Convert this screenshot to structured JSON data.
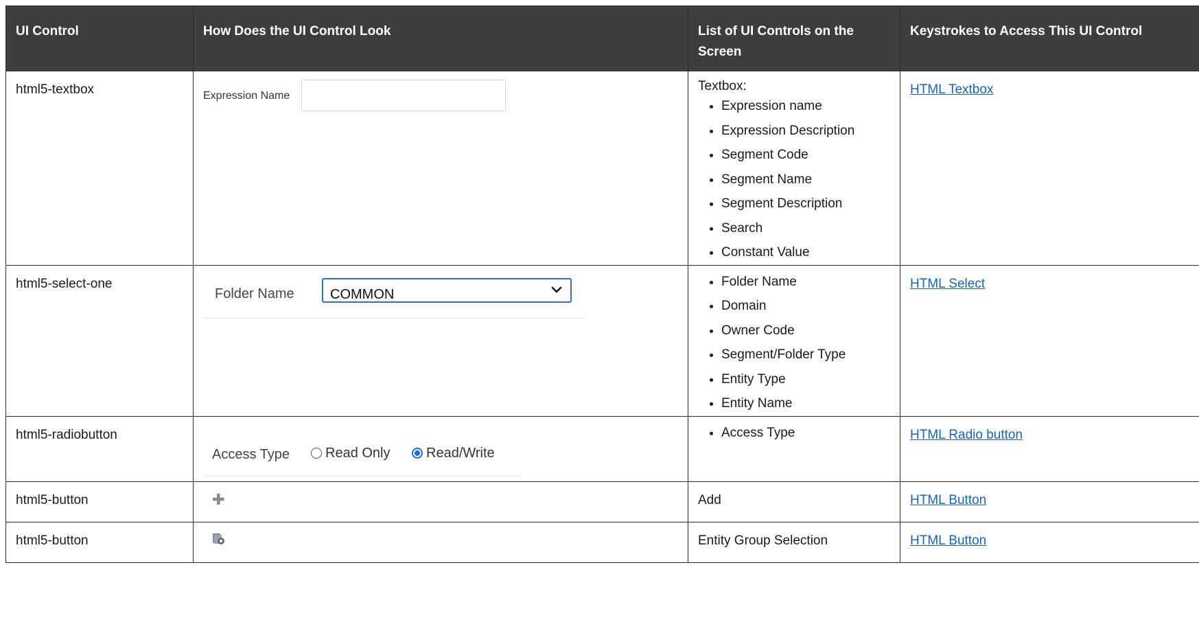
{
  "table": {
    "headers": [
      "UI Control",
      "How Does the UI Control Look",
      "List of UI Controls on the Screen",
      "Keystrokes to Access This UI Control"
    ],
    "rows": [
      {
        "control": "html5-textbox",
        "preview": {
          "label": "Expression Name",
          "value": ""
        },
        "list_intro": "Textbox:",
        "list": [
          "Expression name",
          "Expression Description",
          "Segment Code",
          "Segment Name",
          "Segment Description",
          "Search",
          "Constant Value"
        ],
        "link": "HTML Textbox"
      },
      {
        "control": "html5-select-one",
        "preview": {
          "label": "Folder Name",
          "value": "COMMON"
        },
        "list": [
          "Folder Name",
          "Domain",
          "Owner Code",
          "Segment/Folder Type",
          "Entity Type",
          "Entity Name"
        ],
        "link": "HTML Select"
      },
      {
        "control": "html5-radiobutton",
        "preview": {
          "label": "Access Type",
          "option1": "Read Only",
          "option2": "Read/Write",
          "selected": "Read/Write"
        },
        "list": [
          "Access Type"
        ],
        "link": "HTML Radio button"
      },
      {
        "control": "html5-button",
        "preview": {
          "icon": "plus-icon"
        },
        "text": "Add",
        "link": "HTML Button"
      },
      {
        "control": "html5-button",
        "preview": {
          "icon": "entity-group-icon"
        },
        "text": "Entity Group Selection",
        "link": "HTML Button"
      }
    ]
  },
  "colors": {
    "header_bg": "#3d3d3d",
    "link": "#1565c0",
    "select_border": "#2a6ddb",
    "radio_selected": "#1a6fe0"
  }
}
